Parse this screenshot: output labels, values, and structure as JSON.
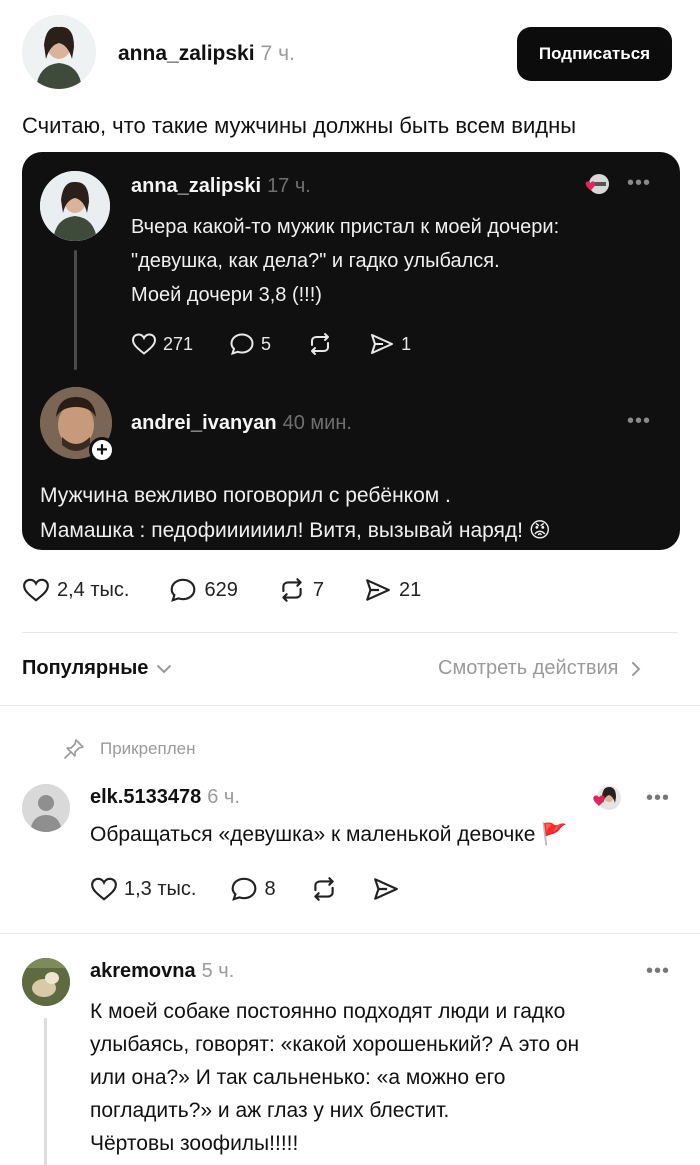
{
  "post": {
    "author": "anna_zalipski",
    "time": "7 ч.",
    "subscribe_label": "Подписаться",
    "text": "Считаю, что такие мужчины должны быть всем видны",
    "likes": "2,4 тыс.",
    "comments": "629",
    "reposts": "7",
    "shares": "21"
  },
  "quoted": {
    "author": "anna_zalipski",
    "time": "17 ч.",
    "lines": [
      "Вчера какой-то мужик пристал к моей дочери:",
      "\"девушка, как дела?\" и гадко улыбался.",
      "Моей дочери 3,8 (!!!)"
    ],
    "likes": "271",
    "comments": "5",
    "shares": "1",
    "reply": {
      "author": "andrei_ivanyan",
      "time": "40 мин.",
      "lines": [
        "Мужчина вежливо поговорил с ребёнком .",
        "Мамашка : педофиииииил! Витя, вызывай наряд! 😡"
      ]
    }
  },
  "filter": {
    "sort_label": "Популярные",
    "view_actions_label": "Смотреть действия"
  },
  "pinned_label": "Прикреплен",
  "comments": [
    {
      "author": "elk.5133478",
      "time": "6 ч.",
      "text": "Обращаться «девушка» к маленькой девочке 🚩",
      "likes": "1,3 тыс.",
      "replies": "8"
    },
    {
      "author": "akremovna",
      "time": "5 ч.",
      "lines": [
        "К моей собаке постоянно подходят люди и гадко",
        "улыбаясь,  говорят: «какой хорошенький? А это он",
        "или она?» И так сальненько: «а можно его",
        "погладить?» и аж глаз у них блестит.",
        "Чёртовы зоофилы!!!!!"
      ]
    }
  ],
  "icons": {
    "heart": "heart-icon",
    "comment": "comment-icon",
    "repost": "repost-icon",
    "share": "share-icon",
    "more": "more-icon",
    "pin": "pin-icon",
    "chevron": "chevron-icon"
  },
  "colors": {
    "card_bg": "#101010",
    "button_bg": "#0c0c0c",
    "muted": "#9a9a9a",
    "like_red": "#e0245e"
  }
}
